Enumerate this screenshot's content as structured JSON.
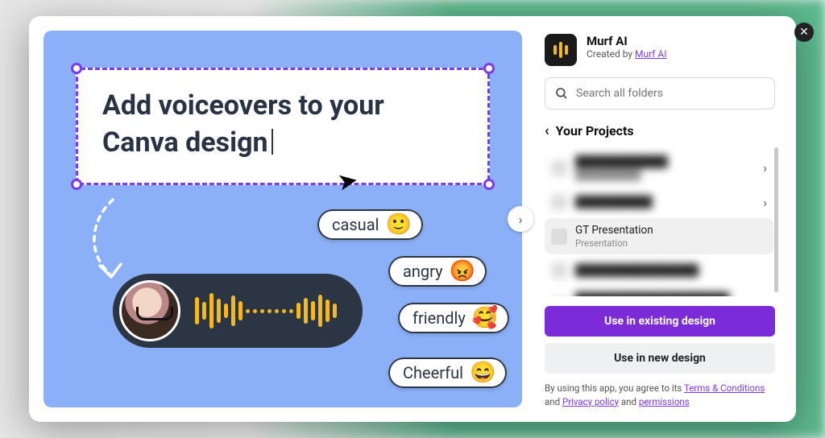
{
  "app": {
    "name": "Murf AI",
    "created_by_prefix": "Created by ",
    "creator": "Murf AI"
  },
  "search": {
    "placeholder": "Search all folders"
  },
  "breadcrumb": {
    "title": "Your Projects"
  },
  "projects": [
    {
      "title": "████████████",
      "subtitle": "██████████",
      "chevron": true,
      "blurred": true
    },
    {
      "title": "██████████",
      "subtitle": "",
      "chevron": true,
      "blurred": true
    },
    {
      "title": "GT Presentation",
      "subtitle": "Presentation",
      "chevron": false,
      "blurred": false,
      "selected": true
    },
    {
      "title": "████████████████",
      "subtitle": "",
      "chevron": false,
      "blurred": true
    },
    {
      "title": "████████████████████",
      "subtitle": "████████████",
      "chevron": false,
      "blurred": true
    }
  ],
  "buttons": {
    "use_existing": "Use in existing design",
    "use_new": "Use in new design"
  },
  "legal": {
    "prefix": "By using this app, you agree to its ",
    "terms": "Terms & Conditions",
    "and1": " and ",
    "privacy": "Privacy policy",
    "and2": " and ",
    "permissions": "permissions"
  },
  "preview": {
    "headline": "Add voiceovers to your Canva design",
    "tags": [
      "casual",
      "angry",
      "friendly",
      "Cheerful"
    ],
    "tag_emojis": [
      "🙂",
      "😡",
      "🥰",
      "😄"
    ]
  }
}
